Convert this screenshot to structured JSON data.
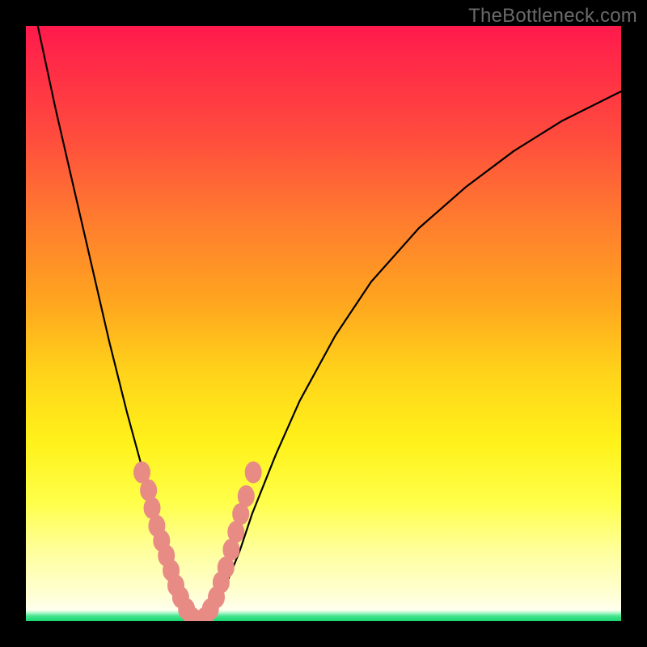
{
  "watermark": "TheBottleneck.com",
  "chart_data": {
    "type": "line",
    "title": "",
    "xlabel": "",
    "ylabel": "",
    "xlim": [
      0,
      100
    ],
    "ylim": [
      0,
      100
    ],
    "grid": false,
    "legend": false,
    "series": [
      {
        "name": "bottleneck-curve",
        "x": [
          2,
          5,
          8,
          11,
          14,
          17,
          20,
          23,
          24,
          25,
          26,
          27,
          28,
          29,
          30,
          31,
          32,
          34,
          36,
          38,
          42,
          46,
          52,
          58,
          66,
          74,
          82,
          90,
          100
        ],
        "y": [
          100,
          86,
          73,
          60,
          47,
          35,
          24,
          14,
          11,
          8,
          5,
          2,
          0,
          0,
          0,
          1,
          3,
          7,
          12,
          18,
          28,
          37,
          48,
          57,
          66,
          73,
          79,
          84,
          89
        ]
      }
    ],
    "markers": [
      {
        "name": "highlight-dots",
        "x": [
          19.5,
          20.6,
          21.2,
          22.0,
          22.8,
          23.6,
          24.4,
          25.2,
          26.0,
          27.0,
          28.0,
          29.0,
          30.0,
          31.0,
          32.0,
          32.8,
          33.6,
          34.5,
          35.3,
          36.1,
          37.0,
          38.2
        ],
        "y": [
          25.0,
          22.0,
          19.0,
          16.0,
          13.5,
          11.0,
          8.5,
          6.0,
          4.0,
          2.0,
          0.5,
          0.0,
          0.5,
          2.0,
          4.0,
          6.5,
          9.0,
          12.0,
          15.0,
          18.0,
          21.0,
          25.0
        ]
      }
    ],
    "background_gradient": [
      "#ff1a4c",
      "#ffa41f",
      "#fff21a",
      "#ffffff"
    ],
    "baseline_strip_color": "#18d66f"
  }
}
